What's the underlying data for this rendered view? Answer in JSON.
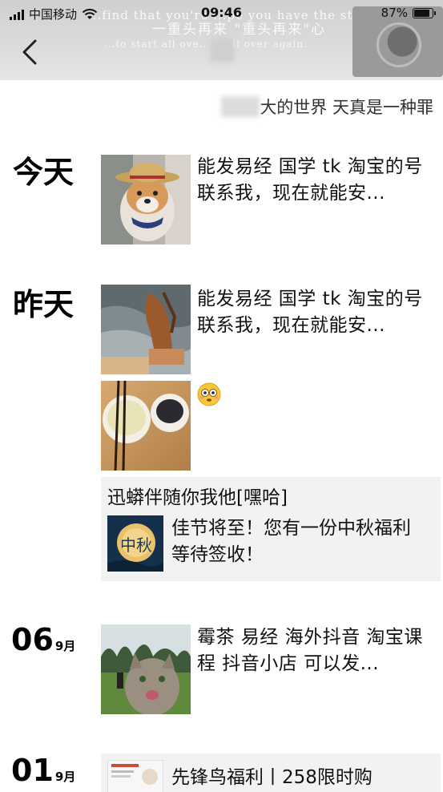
{
  "status_bar": {
    "carrier": "中国移动",
    "time": "09:46",
    "battery_percent": "87%",
    "battery_level": 0.87
  },
  "cover": {
    "line1": "...find that you're ...pe you have the stre...",
    "line2": "一重头再来  \"重头再来\"心",
    "line3": "...to start all ove...    ...all over again."
  },
  "header": {
    "back_icon": "chevron-left-icon"
  },
  "signature": {
    "text": "大的世界 天真是一种罪"
  },
  "feed": {
    "today": {
      "label": "今天",
      "post_text": "能发易经 国学 tk 淘宝的号联系我，现在就能安..."
    },
    "yesterday": {
      "label": "昨天",
      "post_text": "能发易经 国学 tk 淘宝的号联系我，现在就能安...",
      "share": {
        "title": "迅蟒伴随你我他[嘿哈]",
        "text": "佳节将至！您有一份中秋福利等待签收！",
        "image_label": "中秋"
      }
    },
    "sep06": {
      "day": "06",
      "month": "9月",
      "post_text": "霉茶 易经 海外抖音 淘宝课程 抖音小店 可以发..."
    },
    "sep01": {
      "day": "01",
      "month": "9月",
      "link_text": "先锋鸟福利丨258限时购"
    }
  }
}
